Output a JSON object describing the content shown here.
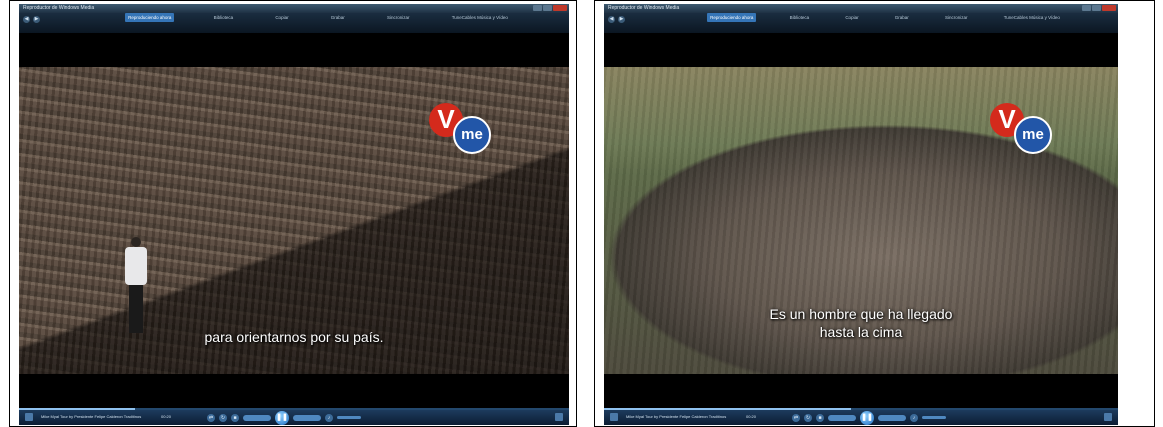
{
  "players": [
    {
      "window_title": "Reproductor de Windows Media",
      "tabs": [
        "Reproduciendo ahora",
        "Biblioteca",
        "Copiar",
        "Grabar",
        "Sincronizar",
        "TuneCables Música y Vídeo"
      ],
      "active_tab": 0,
      "logo": {
        "v": "V",
        "me": "me"
      },
      "subtitle_lines": [
        "para orientarnos por su país."
      ],
      "now_playing": "Mike Myal Tour by Presidente Felipe Calderon Traditinos",
      "time": "00:20",
      "seek_progress": 0.21
    },
    {
      "window_title": "Reproductor de Windows Media",
      "tabs": [
        "Reproduciendo ahora",
        "Biblioteca",
        "Copiar",
        "Grabar",
        "Sincronizar",
        "TuneCables Música y Vídeo"
      ],
      "active_tab": 0,
      "logo": {
        "v": "V",
        "me": "me"
      },
      "subtitle_lines": [
        "Es un hombre que ha llegado",
        "hasta la cima"
      ],
      "now_playing": "Mike Myal Tour by Presidente Felipe Calderon Traditinos",
      "time": "00:20",
      "seek_progress": 0.48
    }
  ],
  "icons": {
    "back": "arrow-left-icon",
    "forward": "arrow-right-icon",
    "play": "pause-icon",
    "stop": "stop-icon",
    "volume": "volume-icon"
  },
  "colors": {
    "active_tab": "#3575b7",
    "logo_red": "#d42a1c",
    "logo_blue": "#2256a8",
    "control_bar": "#1f3f63"
  }
}
